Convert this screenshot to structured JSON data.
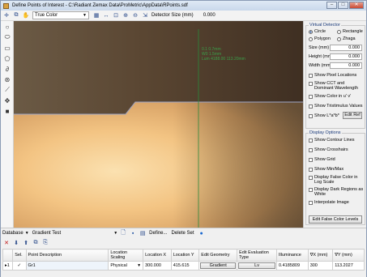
{
  "window": {
    "title": "Define Points of Interest - C:\\Radiant Zemax Data\\ProMetric\\AppData\\RPoints.sdf",
    "buttons": [
      "–",
      "□",
      "✕"
    ]
  },
  "toolbar": {
    "color_mode": "True Color",
    "detector_size_label": "Detector Size (mm)",
    "detector_size_value": "0.000"
  },
  "viewer": {
    "annotation_line1": "0.1 0.7mm",
    "annotation_line2": "W0 1.5mm",
    "annotation_line3": "Lum 4188.00  113.20mm"
  },
  "virtual_detector": {
    "header": "Virtual Detector",
    "shapes": [
      "Circle",
      "Rectangle",
      "Polygon",
      "Zhaga"
    ],
    "selected_shape": "Circle",
    "size_label": "Size (mm)",
    "size_value": "0.000",
    "height_label": "Height (mm)",
    "height_value": "0.000",
    "width_label": "Width (mm)",
    "width_value": "0.000",
    "show_pixel_locations": "Show Pixel Locations",
    "show_cct": "Show CCT and Dominant Wavelength",
    "show_color_uv": "Show Color in u' v'",
    "show_tristimulus": "Show Tristimulus Values",
    "show_lab": "Show L*a*b*",
    "edit_ref": "Edit Ref"
  },
  "display_options": {
    "header": "Display Options",
    "items": [
      "Show Contour Lines",
      "Show Crosshairs",
      "Show Grid",
      "Show Min/Max",
      "Display False Color in Log Scale",
      "Display Dark Regions as White",
      "Interpolate Image"
    ],
    "edit_false_color": "Edit False Color Levels"
  },
  "bottom": {
    "database_label": "Database",
    "test_label": "Gradient Test",
    "define_label": "Define...",
    "delete_set_label": "Delete Set"
  },
  "table": {
    "headers": [
      "",
      "Sel.",
      "Point Description",
      "Location Scaling",
      "Location X",
      "Location Y",
      "Edit Geometry",
      "Edit Evaluation Type",
      "Illuminance",
      "∇X (mm)",
      "∇Y (mm)"
    ],
    "rows": [
      {
        "marker": "▸1",
        "sel": "✓",
        "description": "Gr1",
        "scaling": "Physical",
        "x": "300.000",
        "y": "415.615",
        "geometry_button": "Gradient",
        "eval_button": "Lv",
        "illuminance": "0.4185809",
        "dx": "300",
        "dy": "113.2027"
      }
    ]
  }
}
